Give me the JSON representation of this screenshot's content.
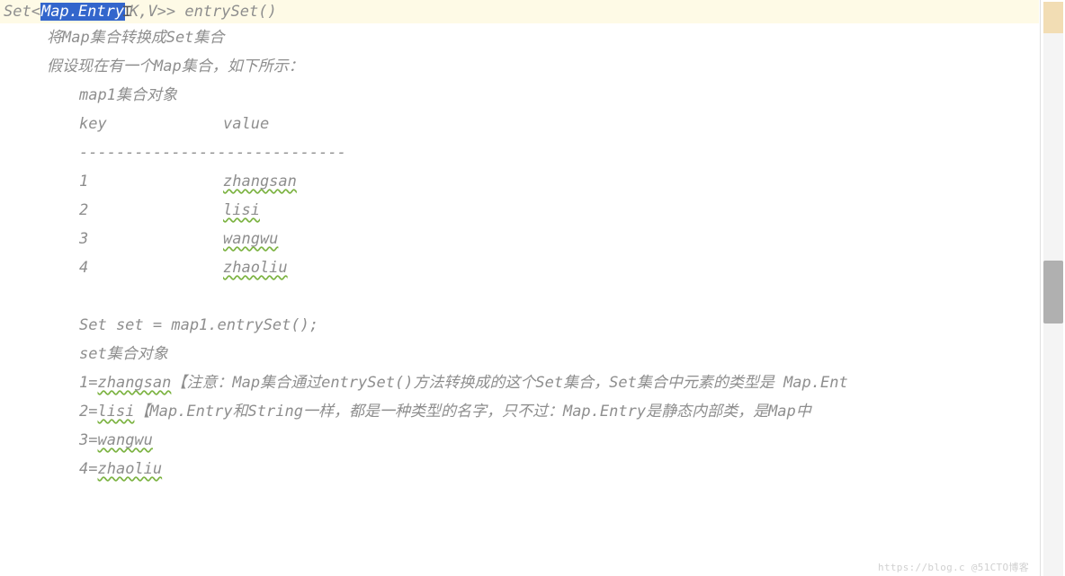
{
  "header": {
    "prefix": "Set<",
    "selected": "Map.Entry",
    "suffix_before_cursor": "",
    "cursor_char": "⌶",
    "suffix": "K,V>> entrySet()"
  },
  "lines": {
    "l1": "将Map集合转换成Set集合",
    "l2": "假设现在有一个Map集合，如下所示：",
    "l3": "map1集合对象",
    "l4_key": "key",
    "l4_value": "value",
    "l5": "-----------------------------",
    "pairs": [
      {
        "key": "1",
        "value": "zhangsan"
      },
      {
        "key": "2",
        "value": "lisi"
      },
      {
        "key": "3",
        "value": "wangwu"
      },
      {
        "key": "4",
        "value": "zhaoliu"
      }
    ],
    "l10": "Set set = map1.entrySet();",
    "l11": "set集合对象",
    "entry1_left": "1=",
    "entry1_val": "zhangsan",
    "note1": "   【注意：Map集合通过entrySet()方法转换成的这个Set集合，Set集合中元素的类型是 Map.Ent",
    "entry2_left": "2=",
    "entry2_val": "lisi",
    "note2": "          【Map.Entry和String一样，都是一种类型的名字，只不过：Map.Entry是静态内部类，是Map中",
    "entry3_left": "3=",
    "entry3_val": "wangwu",
    "entry4_left": "4=",
    "entry4_val": "zhaoliu"
  },
  "watermark": "https://blog.c @51CTO博客"
}
